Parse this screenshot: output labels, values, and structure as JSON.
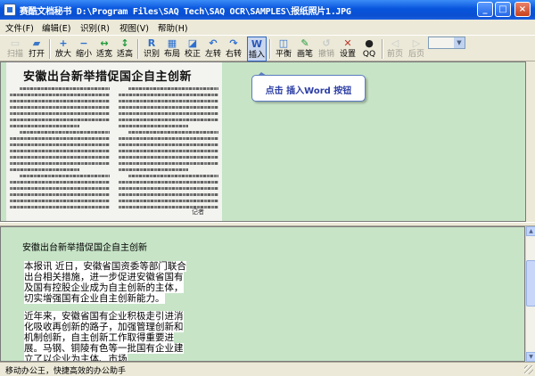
{
  "titlebar": {
    "title": "赛酷文档秘书 D:\\Program Files\\SAQ Tech\\SAQ OCR\\SAMPLES\\报纸照片1.JPG",
    "minimize": "_",
    "maximize": "□",
    "close": "×"
  },
  "menu": {
    "items": [
      "文件(F)",
      "编辑(E)",
      "识别(R)",
      "视图(V)",
      "帮助(H)"
    ]
  },
  "toolbar": {
    "items": [
      {
        "label": "扫描",
        "icon": "scanner-icon",
        "glyph": "▭",
        "color": "#9aa7b8",
        "disabled": true
      },
      {
        "label": "打开",
        "icon": "open-folder-icon",
        "glyph": "▰",
        "color": "#3c78c8",
        "disabled": false
      },
      {
        "label": "放大",
        "icon": "zoom-in-icon",
        "glyph": "+",
        "color": "#2d6fd0",
        "disabled": false
      },
      {
        "label": "缩小",
        "icon": "zoom-out-icon",
        "glyph": "−",
        "color": "#2d6fd0",
        "disabled": false
      },
      {
        "label": "适宽",
        "icon": "fit-width-icon",
        "glyph": "↔",
        "color": "#1f9a3a",
        "disabled": false
      },
      {
        "label": "适高",
        "icon": "fit-height-icon",
        "glyph": "↕",
        "color": "#1f9a3a",
        "disabled": false
      },
      {
        "label": "识别",
        "icon": "recognize-icon",
        "glyph": "R",
        "color": "#2d6fd0",
        "disabled": false
      },
      {
        "label": "布局",
        "icon": "layout-icon",
        "glyph": "▦",
        "color": "#2d6fd0",
        "disabled": false
      },
      {
        "label": "校正",
        "icon": "deskew-icon",
        "glyph": "◪",
        "color": "#2d6fd0",
        "disabled": false
      },
      {
        "label": "左转",
        "icon": "rotate-left-icon",
        "glyph": "↶",
        "color": "#2d6fd0",
        "disabled": false
      },
      {
        "label": "右转",
        "icon": "rotate-right-icon",
        "glyph": "↷",
        "color": "#2d6fd0",
        "disabled": false
      },
      {
        "label": "插入",
        "icon": "word-insert-icon",
        "glyph": "W",
        "color": "#2b57b8",
        "disabled": false,
        "active": true
      },
      {
        "label": "平衡",
        "icon": "balance-icon",
        "glyph": "◫",
        "color": "#2d6fd0",
        "disabled": false
      },
      {
        "label": "画笔",
        "icon": "pen-icon",
        "glyph": "✎",
        "color": "#1f9a3a",
        "disabled": false
      },
      {
        "label": "撤销",
        "icon": "undo-icon",
        "glyph": "↺",
        "color": "#9aa7b8",
        "disabled": true
      },
      {
        "label": "设置",
        "icon": "settings-tools-icon",
        "glyph": "✕",
        "color": "#c0392b",
        "disabled": false
      },
      {
        "label": "QQ",
        "icon": "qq-penguin-icon",
        "glyph": "●",
        "color": "#222222",
        "disabled": false
      },
      {
        "label": "前页",
        "icon": "prev-page-icon",
        "glyph": "◁",
        "color": "#9aa7b8",
        "disabled": true
      },
      {
        "label": "后页",
        "icon": "next-page-icon",
        "glyph": "▷",
        "color": "#9aa7b8",
        "disabled": true
      }
    ],
    "page_combo_value": ""
  },
  "image_pane": {
    "headline": "安徽出台新举措促国企自主创新",
    "byline": "记者"
  },
  "tooltip": {
    "text": "点击 插入Word 按钮"
  },
  "text_pane": {
    "title": "安徽出台新举措促国企自主创新",
    "paragraphs": [
      "本报讯 近日，安徽省国资委等部门联合出台相关措施，进一步促进安徽省国有及国有控股企业成为自主创新的主体，切实增强国有企业自主创新能力。",
      "近年来，安徽省国有企业积极走引进消化吸收再创新的路子，加强管理创新和机制创新，自主创新工作取得重要进展。马钢、铜陵有色等一批国有企业建立了以企业为主体、市场"
    ]
  },
  "statusbar": {
    "text": "移动办公王，快捷高效的办公助手"
  },
  "colors": {
    "pane_background": "#c7e4c7",
    "titlebar_blue": "#0a4fd0",
    "tooltip_text": "#2c3ea5"
  }
}
